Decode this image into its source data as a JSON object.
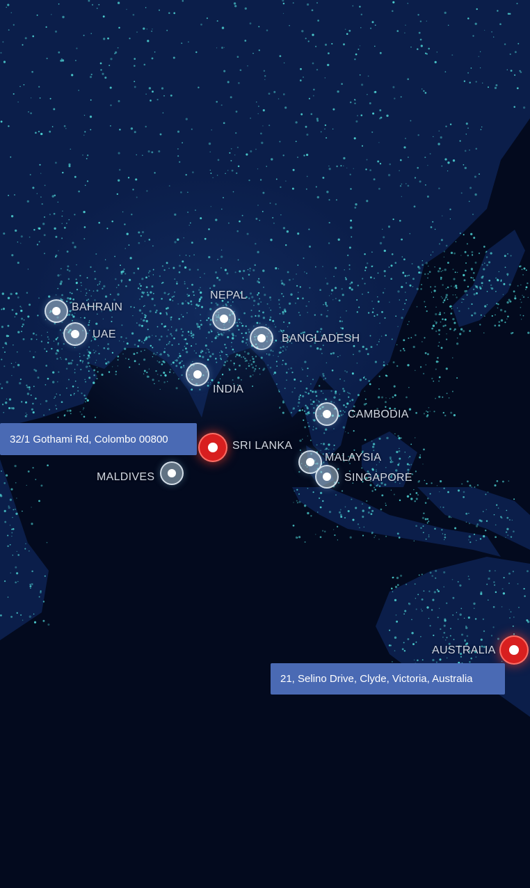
{
  "map": {
    "locations": [
      {
        "name": "BAHRAIN",
        "type": "location"
      },
      {
        "name": "UAE",
        "type": "location"
      },
      {
        "name": "NEPAL",
        "type": "location"
      },
      {
        "name": "BANGLADESH",
        "type": "location"
      },
      {
        "name": "INDIA",
        "type": "location"
      },
      {
        "name": "CAMBODIA",
        "type": "location"
      },
      {
        "name": "SRI LANKA",
        "type": "office"
      },
      {
        "name": "MALDIVES",
        "type": "location"
      },
      {
        "name": "MALAYSIA",
        "type": "location"
      },
      {
        "name": "SINGAPORE",
        "type": "location"
      },
      {
        "name": "AUSTRALIA",
        "type": "office"
      }
    ],
    "addresses": {
      "sri_lanka": "32/1 Gothami Rd, Colombo 00800",
      "australia": "21, Selino Drive, Clyde, Victoria, Australia"
    },
    "colors": {
      "background": "#030a1e",
      "land": "#0b1e4a",
      "city_lights": "#4fd6d6",
      "office_marker": "#d81f1f",
      "location_marker": "#afc8d7",
      "address_box": "#4a6ab4"
    }
  }
}
